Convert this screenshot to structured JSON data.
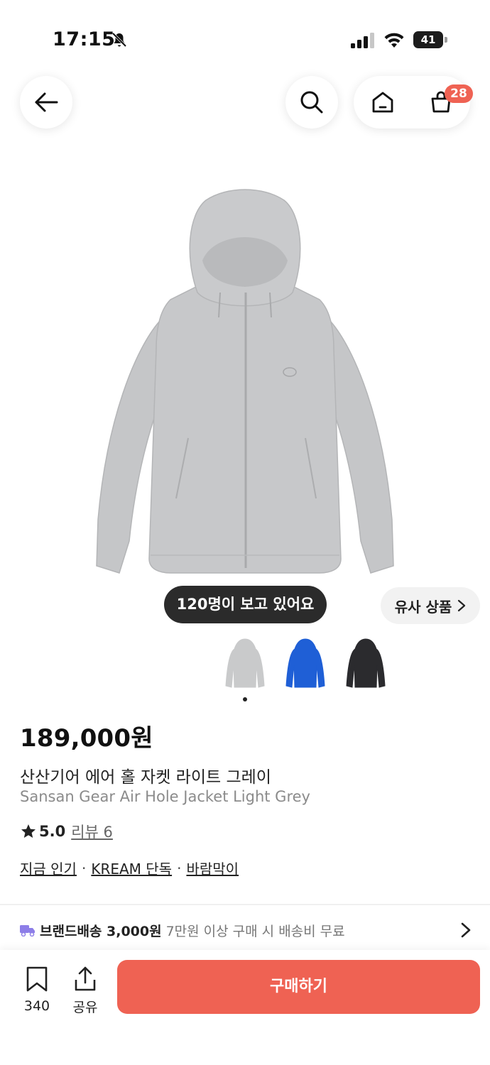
{
  "status_bar": {
    "time": "17:15",
    "battery": "41"
  },
  "nav": {
    "cart_badge": "28"
  },
  "product": {
    "viewers": "120명이 보고 있어요",
    "similar_label": "유사 상품",
    "colors": [
      {
        "name": "light-grey",
        "color": "#c9cacb"
      },
      {
        "name": "blue",
        "color": "#1f5fd6"
      },
      {
        "name": "black",
        "color": "#2b2b2e"
      }
    ],
    "selected_color_index": 0,
    "price": "189,000원",
    "title_ko": "산산기어 에어 홀 자켓 라이트 그레이",
    "title_en": "Sansan Gear Air Hole Jacket Light Grey",
    "rating": "5.0",
    "review_label": "리뷰 6",
    "tags": [
      "지금 인기",
      "KREAM 단독",
      "바람막이"
    ],
    "tag_separator": "·"
  },
  "delivery": {
    "label": "브랜드배송 3,000원",
    "note": "7만원 이상 구매 시 배송비 무료",
    "icon_color": "#8d7ee8"
  },
  "bottom_bar": {
    "bookmark_count": "340",
    "share_label": "공유",
    "buy_label": "구매하기",
    "accent": "#ef6253"
  }
}
